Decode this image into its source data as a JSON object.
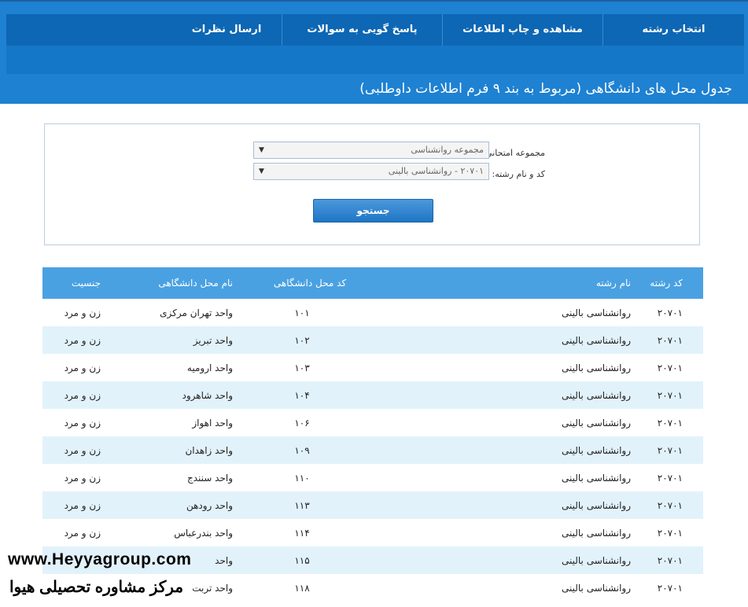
{
  "nav": {
    "items": [
      {
        "label": "انتخاب رشته"
      },
      {
        "label": "مشاهده و چاپ اطلاعات"
      },
      {
        "label": "پاسخ گویی به سوالات"
      },
      {
        "label": "ارسال نظرات"
      }
    ]
  },
  "page": {
    "title": "جدول محل های دانشگاهی (مربوط به بند ۹ فرم اطلاعات داوطلبی)"
  },
  "filter": {
    "group_label": "مجموعه امتحانی:",
    "group_value": "مجموعه روانشناسی",
    "field_label": "کد و نام رشته:",
    "field_value": "۲۰۷۰۱ - روانشناسی بالینی",
    "search_label": "جستجو"
  },
  "table": {
    "headers": {
      "code": "کد رشته",
      "name": "نام رشته",
      "uni_code": "کد محل دانشگاهی",
      "uni_name": "نام محل دانشگاهی",
      "gender": "جنسیت"
    },
    "rows": [
      {
        "code": "۲۰۷۰۱",
        "name": "روانشناسی بالینی",
        "uni_code": "۱۰۱",
        "uni_name": "واحد تهران مرکزی",
        "gender": "زن و مرد"
      },
      {
        "code": "۲۰۷۰۱",
        "name": "روانشناسی بالینی",
        "uni_code": "۱۰۲",
        "uni_name": "واحد تبریز",
        "gender": "زن و مرد"
      },
      {
        "code": "۲۰۷۰۱",
        "name": "روانشناسی بالینی",
        "uni_code": "۱۰۳",
        "uni_name": "واحد ارومیه",
        "gender": "زن و مرد"
      },
      {
        "code": "۲۰۷۰۱",
        "name": "روانشناسی بالینی",
        "uni_code": "۱۰۴",
        "uni_name": "واحد شاهرود",
        "gender": "زن و مرد"
      },
      {
        "code": "۲۰۷۰۱",
        "name": "روانشناسی بالینی",
        "uni_code": "۱۰۶",
        "uni_name": "واحد اهواز",
        "gender": "زن و مرد"
      },
      {
        "code": "۲۰۷۰۱",
        "name": "روانشناسی بالینی",
        "uni_code": "۱۰۹",
        "uni_name": "واحد زاهدان",
        "gender": "زن و مرد"
      },
      {
        "code": "۲۰۷۰۱",
        "name": "روانشناسی بالینی",
        "uni_code": "۱۱۰",
        "uni_name": "واحد سنندج",
        "gender": "زن و مرد"
      },
      {
        "code": "۲۰۷۰۱",
        "name": "روانشناسی بالینی",
        "uni_code": "۱۱۳",
        "uni_name": "واحد رودهن",
        "gender": "زن و مرد"
      },
      {
        "code": "۲۰۷۰۱",
        "name": "روانشناسی بالینی",
        "uni_code": "۱۱۴",
        "uni_name": "واحد بندرعباس",
        "gender": "زن و مرد"
      },
      {
        "code": "۲۰۷۰۱",
        "name": "روانشناسی بالینی",
        "uni_code": "۱۱۵",
        "uni_name": "واحد",
        "gender": ""
      },
      {
        "code": "۲۰۷۰۱",
        "name": "روانشناسی بالینی",
        "uni_code": "۱۱۸",
        "uni_name": "واحد تربت",
        "gender": ""
      }
    ]
  },
  "watermark": {
    "url": "www.Heyyagroup.com",
    "name": "مرکز مشاوره تحصیلی هیوا"
  }
}
